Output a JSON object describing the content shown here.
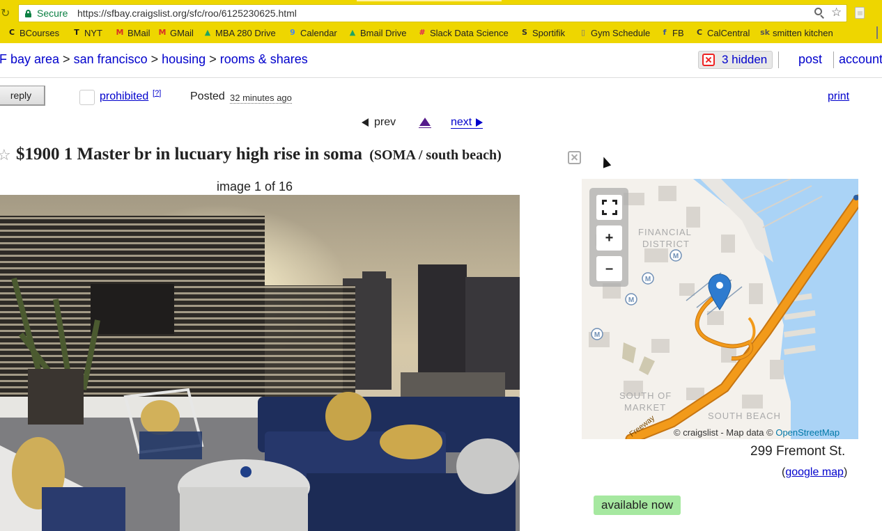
{
  "browser": {
    "secure_label": "Secure",
    "url": "https://sfbay.craigslist.org/sfc/roo/6125230625.html",
    "bookmarks": [
      {
        "label": "BCourses",
        "icon": "bcourses-icon",
        "color": "#1a1a1a"
      },
      {
        "label": "NYT",
        "icon": "nyt-icon",
        "color": "#1a1a1a"
      },
      {
        "label": "BMail",
        "icon": "gmail-icon",
        "color": "#d93025"
      },
      {
        "label": "GMail",
        "icon": "gmail-icon",
        "color": "#d93025"
      },
      {
        "label": "MBA 280 Drive",
        "icon": "drive-icon",
        "color": "#1fa463"
      },
      {
        "label": "Calendar",
        "icon": "calendar-icon",
        "color": "#4285f4"
      },
      {
        "label": "Bmail Drive",
        "icon": "drive-icon",
        "color": "#1fa463"
      },
      {
        "label": "Slack Data Science",
        "icon": "slack-icon",
        "color": "#e01e5a"
      },
      {
        "label": "Sportifik",
        "icon": "sportifik-icon",
        "color": "#333333"
      },
      {
        "label": "Gym Schedule",
        "icon": "page-icon",
        "color": "#777777"
      },
      {
        "label": "FB",
        "icon": "facebook-icon",
        "color": "#3b5998"
      },
      {
        "label": "CalCentral",
        "icon": "calcentral-icon",
        "color": "#333333"
      },
      {
        "label": "smitten kitchen",
        "icon": "smitten-kitchen-icon",
        "color": "#555555"
      }
    ]
  },
  "header": {
    "crumbs": [
      "F bay area",
      "san francisco",
      "housing",
      "rooms & shares"
    ],
    "hidden_label": "3 hidden",
    "post_label": "post",
    "account_label": "account"
  },
  "posting": {
    "reply_label": "reply",
    "prohibited_label": "prohibited",
    "help_mark": "?",
    "posted_label": "Posted",
    "posted_time": "32 minutes ago",
    "print_label": "print",
    "prev_label": "prev",
    "next_label": "next",
    "title": "$1900 1 Master br in lucuary high rise in soma",
    "neighborhood": "(SOMA / south beach)",
    "image_counter": "image 1 of 16"
  },
  "map": {
    "labels": {
      "financial": "FINANCIAL",
      "district": "DISTRICT",
      "south_of": "SOUTH OF",
      "market": "MARKET",
      "south_beach": "SOUTH BEACH",
      "freeway": "Freeway"
    },
    "attribution_prefix": "© craigslist - Map data ©",
    "attribution_link": "OpenStreetMap",
    "address": "299 Fremont St.",
    "google_map_label": "google map",
    "paren_open": "(",
    "paren_close": ")"
  },
  "availability": "available now",
  "colors": {
    "chrome": "#eed600",
    "link": "#0000cc",
    "visited": "#551a8b",
    "available_badge": "#a6e8a0",
    "map_water": "#aad3f6",
    "freeway": "#f29a1a"
  }
}
